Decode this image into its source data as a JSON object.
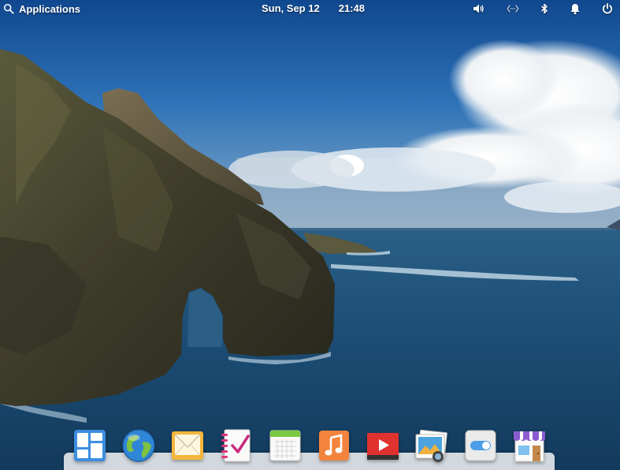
{
  "panel": {
    "applications_label": "Applications",
    "date": "Sun, Sep 12",
    "time": "21:48",
    "indicators": [
      "volume-icon",
      "network-icon",
      "bluetooth-icon",
      "notifications-icon",
      "power-icon"
    ]
  },
  "dock": {
    "items": [
      {
        "icon": "multitasking-view-icon"
      },
      {
        "icon": "web-browser-icon"
      },
      {
        "icon": "mail-icon"
      },
      {
        "icon": "tasks-icon"
      },
      {
        "icon": "calendar-icon"
      },
      {
        "icon": "music-icon"
      },
      {
        "icon": "videos-icon"
      },
      {
        "icon": "photos-icon"
      },
      {
        "icon": "system-settings-icon"
      },
      {
        "icon": "appcenter-icon"
      }
    ]
  },
  "colors": {
    "sky": "#1f5fa6",
    "sea": "#1c4f78",
    "cliff": "#3a3a2a",
    "dock": "#f5f5f5"
  }
}
